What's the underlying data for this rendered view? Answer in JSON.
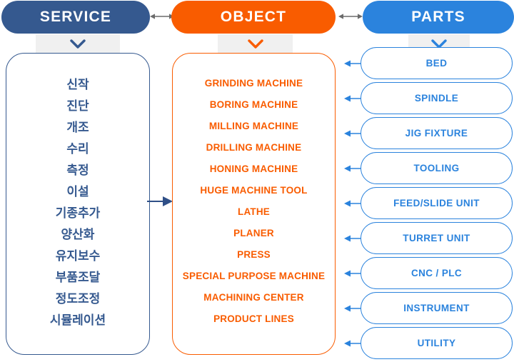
{
  "headers": {
    "service": {
      "label": "SERVICE",
      "color": "#35598f"
    },
    "object": {
      "label": "OBJECT",
      "color": "#f95c00"
    },
    "parts": {
      "label": "PARTS",
      "color": "#2b83dd"
    }
  },
  "connectors": {
    "header_arrow_1": "double-arrow",
    "header_arrow_2": "double-arrow",
    "service_to_object": "right-arrow",
    "chevron": "chevron-down"
  },
  "service_items": [
    "신작",
    "진단",
    "개조",
    "수리",
    "측정",
    "이설",
    "기종추가",
    "양산화",
    "유지보수",
    "부품조달",
    "정도조정",
    "시뮬레이션"
  ],
  "object_items": [
    "GRINDING MACHINE",
    "BORING MACHINE",
    "MILLING MACHINE",
    "DRILLING MACHINE",
    "HONING MACHINE",
    "HUGE MACHINE TOOL",
    "LATHE",
    "PLANER",
    "PRESS",
    "SPECIAL PURPOSE MACHINE",
    "MACHINING CENTER",
    "PRODUCT LINES"
  ],
  "parts_items": [
    "BED",
    "SPINDLE",
    "JIG FIXTURE",
    "TOOLING",
    "FEED/SLIDE UNIT",
    "TURRET UNIT",
    "CNC / PLC",
    "INSTRUMENT",
    "UTILITY"
  ]
}
